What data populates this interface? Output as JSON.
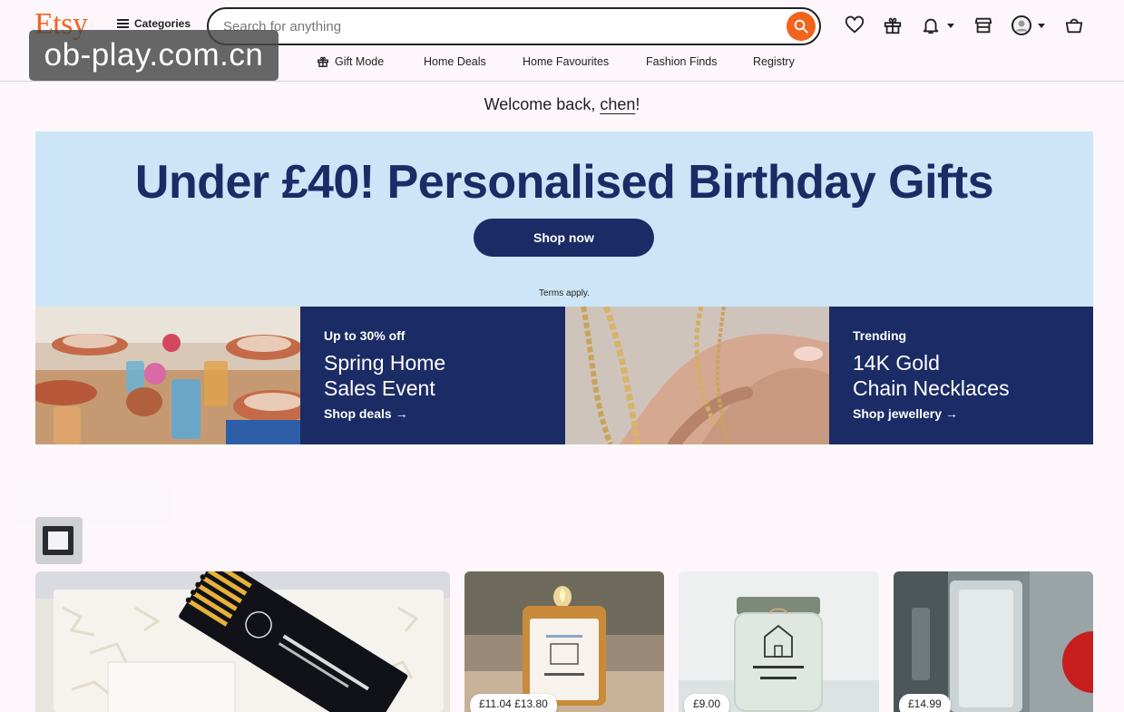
{
  "brand": {
    "logo": "Etsy",
    "accent": "#f1641e",
    "navy": "#1b2b66",
    "hero_bg": "#cce6f7"
  },
  "header": {
    "categories_label": "Categories",
    "search_placeholder": "Search for anything",
    "icons": [
      "heart-icon",
      "gift-icon",
      "bell-icon",
      "store-icon",
      "account-icon",
      "cart-icon"
    ]
  },
  "subnav": {
    "items": [
      {
        "label": "Gift Mode",
        "icon": "gift-icon"
      },
      {
        "label": "Home Deals"
      },
      {
        "label": "Home Favourites"
      },
      {
        "label": "Fashion Finds"
      },
      {
        "label": "Registry"
      }
    ]
  },
  "watermark": "ob-play.com.cn",
  "welcome": {
    "prefix": "Welcome back, ",
    "name": "chen",
    "suffix": "!"
  },
  "hero": {
    "title": "Under £40! Personalised Birthday Gifts",
    "cta": "Shop now",
    "terms": "Terms apply."
  },
  "promos": [
    {
      "kicker": "Up to 30% off",
      "title_line1": "Spring Home",
      "title_line2": "Sales Event",
      "link": "Shop deals →"
    },
    {
      "kicker": "Trending",
      "title_line1": "14K Gold",
      "title_line2": "Chain Necklaces",
      "link": "Shop jewellery →"
    }
  ],
  "products": [
    {
      "price": ""
    },
    {
      "price": "£11.04 £13.80"
    },
    {
      "price": "£9.00"
    },
    {
      "price": "£14.99"
    }
  ]
}
